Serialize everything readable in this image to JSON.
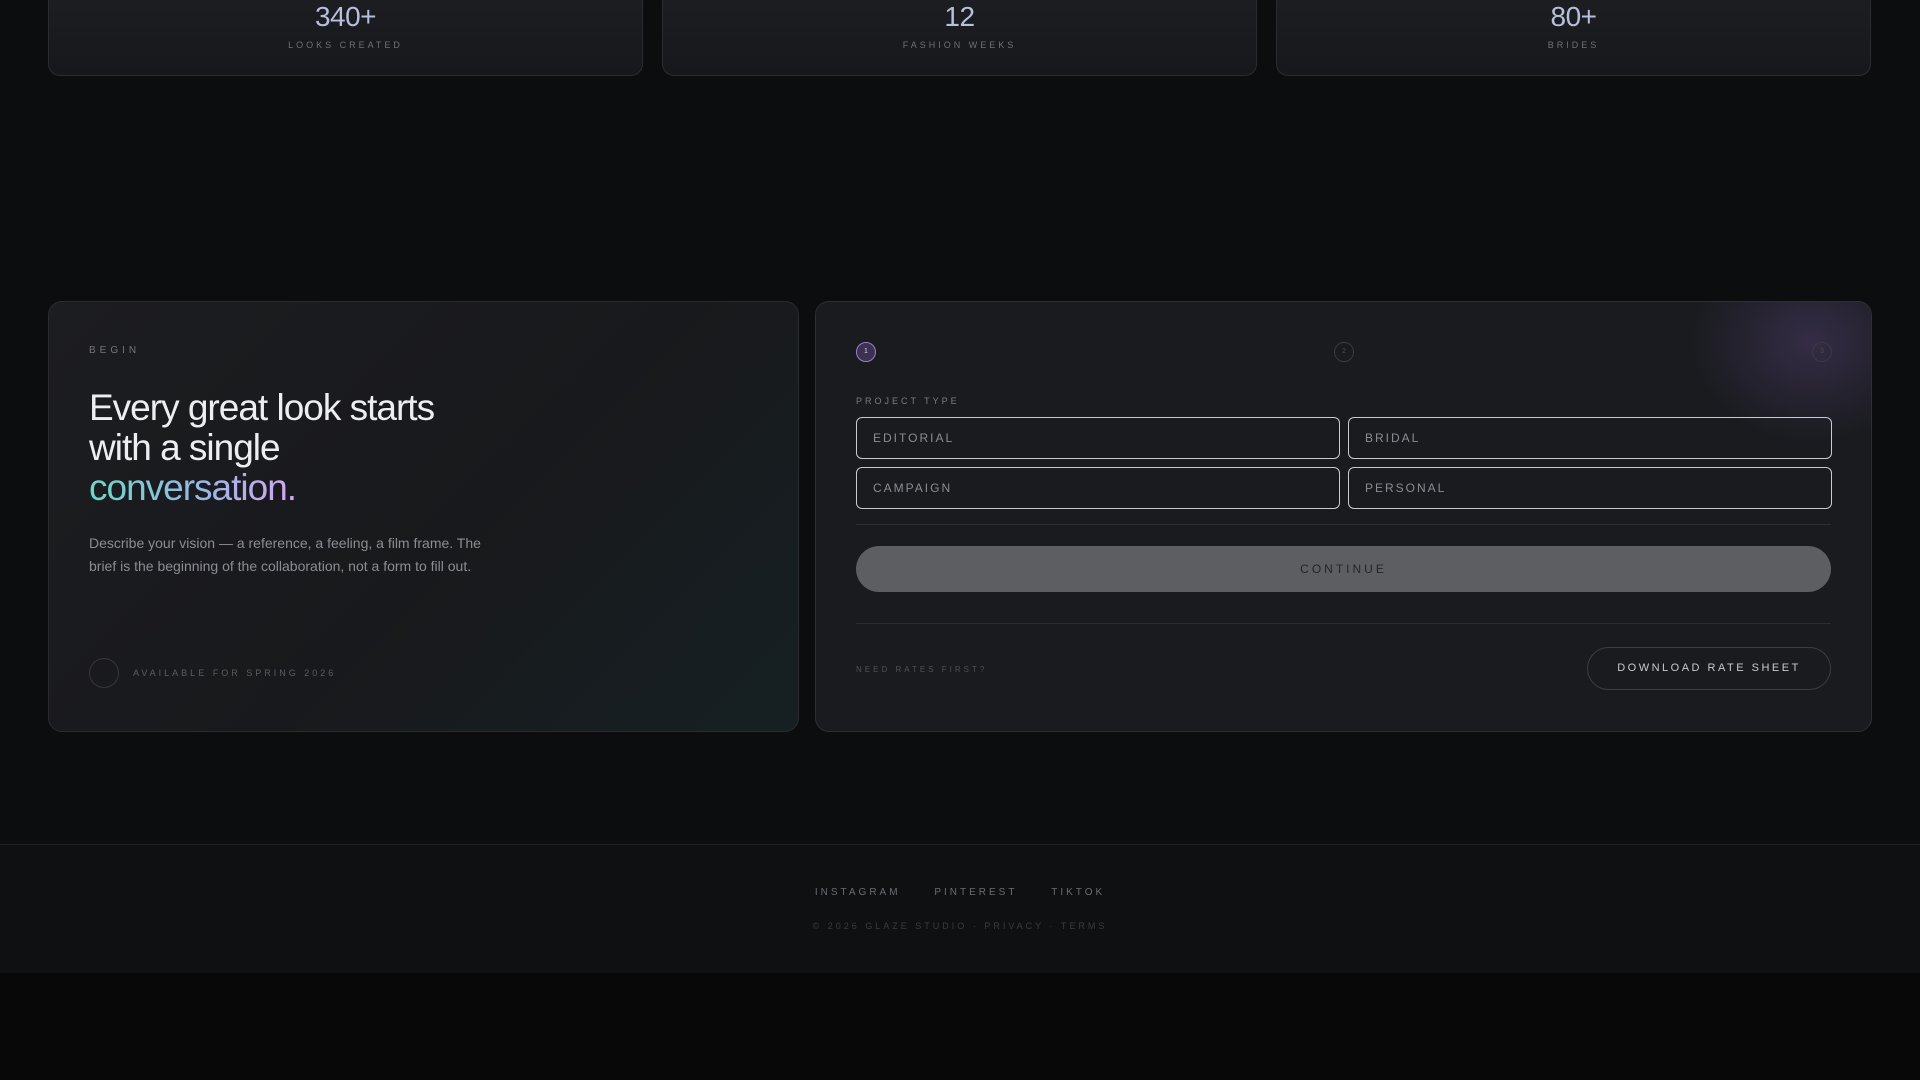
{
  "stats": [
    {
      "value": "340+",
      "label": "LOOKS CREATED"
    },
    {
      "value": "12",
      "label": "FASHION WEEKS"
    },
    {
      "value": "80+",
      "label": "BRIDES"
    }
  ],
  "intro": {
    "eyebrow": "BEGIN",
    "headline_line1": "Every great look starts",
    "headline_line2": "with a single",
    "headline_accent": "conversation.",
    "body": "Describe your vision — a reference, a feeling, a film frame. The brief is the beginning of the collaboration, not a form to fill out.",
    "availability": "AVAILABLE FOR SPRING 2026"
  },
  "form": {
    "steps": [
      "1",
      "2",
      "3"
    ],
    "active_step": 1,
    "project_type_label": "PROJECT TYPE",
    "options": [
      "EDITORIAL",
      "BRIDAL",
      "CAMPAIGN",
      "PERSONAL"
    ],
    "continue_label": "CONTINUE",
    "rates_question": "NEED RATES FIRST?",
    "download_label": "DOWNLOAD RATE SHEET"
  },
  "footer": {
    "links": [
      "INSTAGRAM",
      "PINTEREST",
      "TIKTOK"
    ],
    "copyright": "© 2026 GLAZE STUDIO",
    "privacy": "PRIVACY",
    "terms": "TERMS"
  },
  "colors": {
    "accent_purple": "#9a7fd0",
    "gradient_start": "#6fd6c8",
    "gradient_end": "#d6a6f2"
  }
}
